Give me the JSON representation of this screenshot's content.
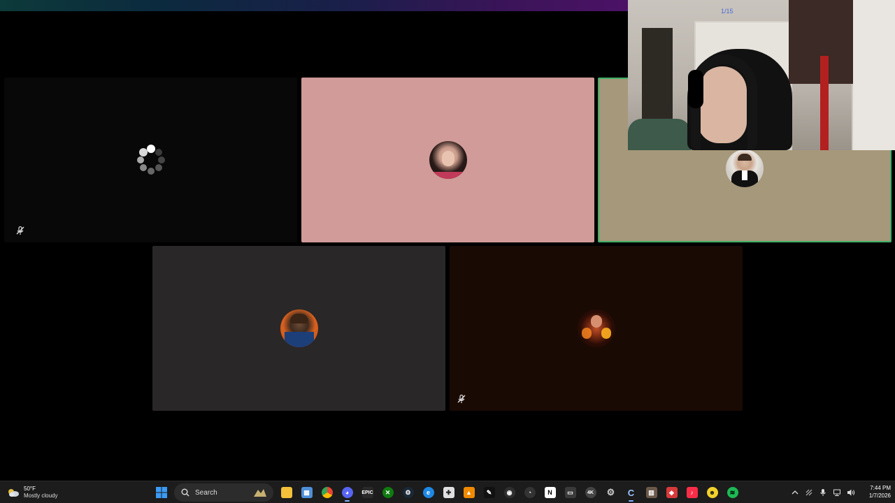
{
  "call": {
    "tiles": [
      {
        "id": "t1",
        "state": "loading",
        "muted": true
      },
      {
        "id": "t2",
        "state": "avatar",
        "muted": false
      },
      {
        "id": "t3",
        "state": "avatar",
        "speaking": true,
        "muted": false
      },
      {
        "id": "t4",
        "state": "avatar",
        "muted": false
      },
      {
        "id": "t5",
        "state": "avatar",
        "muted": true
      }
    ]
  },
  "webcam": {
    "tag": "1/15"
  },
  "taskbar": {
    "weather": {
      "temp": "50°F",
      "condition": "Mostly cloudy",
      "icon": "cloud-sun-icon"
    },
    "search_label": "Search",
    "apps": [
      "start-icon",
      "search-box",
      "file-explorer-icon",
      "microsoft-store-icon",
      "chrome-icon",
      "discord-icon",
      "epic-games-icon",
      "xbox-icon",
      "steam-icon",
      "edge-icon",
      "cursor-icon",
      "vlc-icon",
      "capcut-icon",
      "obs-icon",
      "task-app-icon",
      "notion-icon",
      "terminal-icon",
      "fourk-icon",
      "settings-icon",
      "copilot-icon",
      "office-icon",
      "roblox-icon",
      "apple-music-icon",
      "emoji-icon",
      "spotify-icon"
    ],
    "clock": {
      "time": "7:44 PM",
      "date": "1/7/2026"
    }
  },
  "colors": {
    "speaking_border": "#3fb067",
    "tile2_bg": "#d09b98",
    "tile3_bg": "#a6987a",
    "tile4_bg": "#2a2728",
    "tile5_bg": "#1a0a04"
  }
}
